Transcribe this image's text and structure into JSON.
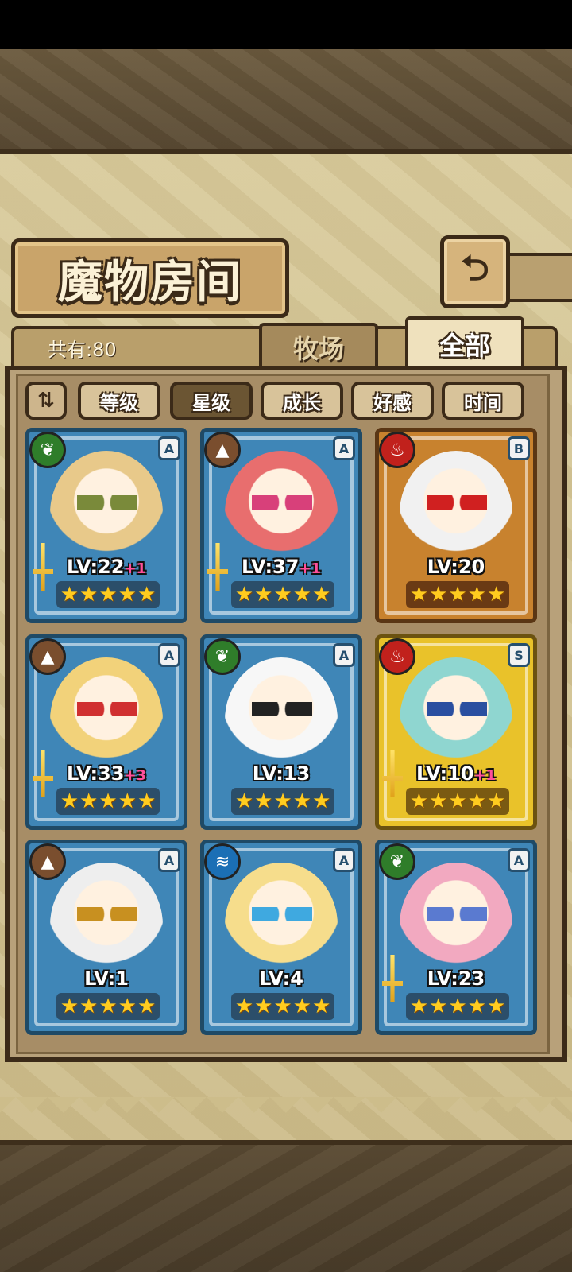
{
  "header": {
    "title": "魔物房间"
  },
  "tabs": {
    "count_label": "共有:80",
    "ranch": "牧场",
    "all": "全部"
  },
  "filters": {
    "sort_icon": "sort-toggle-icon",
    "items": [
      "等级",
      "星级",
      "成长",
      "好感",
      "时间"
    ],
    "active": "星级"
  },
  "monsters": [
    {
      "element": "nature",
      "rank": "A",
      "frame": "blue",
      "level": "LV:22",
      "bonus": "+1",
      "stars": 5
    },
    {
      "element": "earth",
      "rank": "A",
      "frame": "blue",
      "level": "LV:37",
      "bonus": "+1",
      "stars": 5
    },
    {
      "element": "fire",
      "rank": "B",
      "frame": "bronze",
      "level": "LV:20",
      "bonus": "",
      "stars": 5
    },
    {
      "element": "earth",
      "rank": "A",
      "frame": "blue",
      "level": "LV:33",
      "bonus": "+3",
      "stars": 5
    },
    {
      "element": "nature",
      "rank": "A",
      "frame": "blue",
      "level": "LV:13",
      "bonus": "",
      "stars": 5
    },
    {
      "element": "fire",
      "rank": "S",
      "frame": "gold",
      "level": "LV:10",
      "bonus": "+1",
      "stars": 5
    },
    {
      "element": "earth",
      "rank": "A",
      "frame": "blue",
      "level": "LV:1",
      "bonus": "",
      "stars": 5
    },
    {
      "element": "water",
      "rank": "A",
      "frame": "blue",
      "level": "LV:4",
      "bonus": "",
      "stars": 5
    },
    {
      "element": "nature",
      "rank": "A",
      "frame": "blue",
      "level": "LV:23",
      "bonus": "",
      "stars": 5
    }
  ],
  "colors": {
    "panel": "#cdbd8b",
    "frame_dark": "#3b2a18",
    "card_blue": "#3f86b7",
    "card_gold": "#e9c22a",
    "card_bronze": "#c8822e"
  }
}
